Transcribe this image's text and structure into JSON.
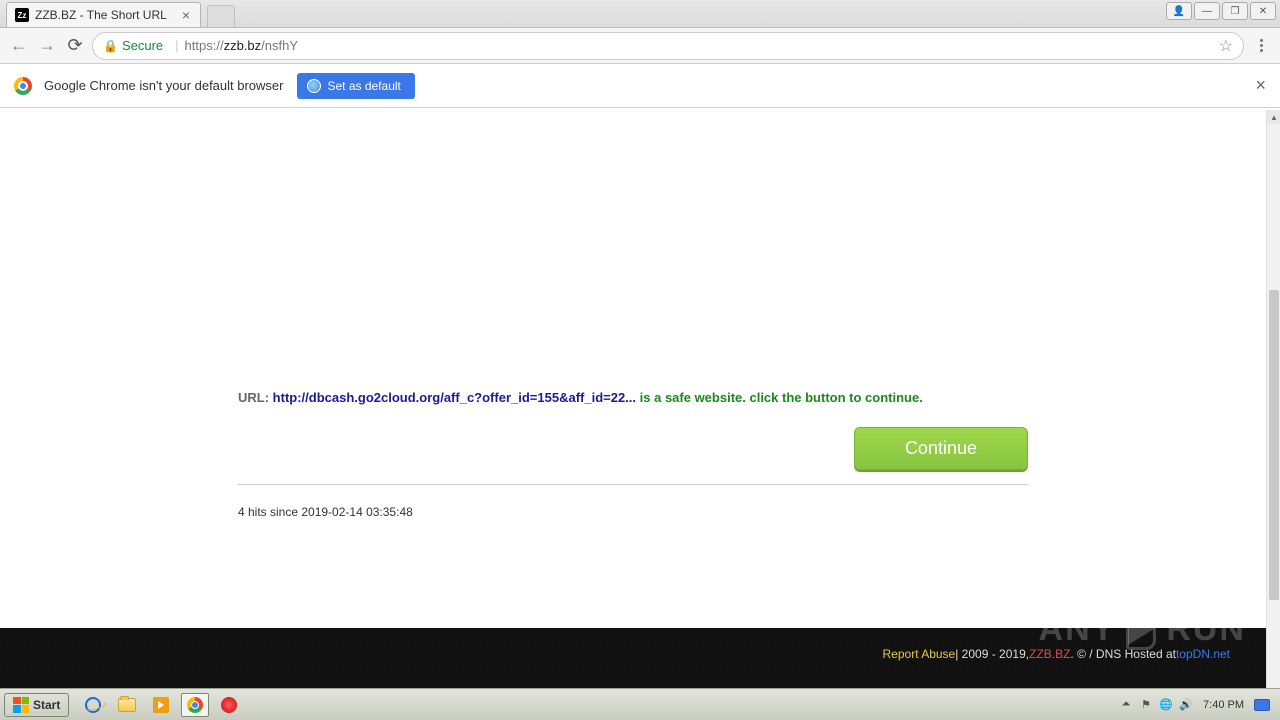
{
  "tab": {
    "title": "ZZB.BZ - The Short URL",
    "favicon_text": "Zz"
  },
  "window_controls": {
    "user": "user",
    "minimize": "minimize",
    "maximize": "maximize",
    "close": "close"
  },
  "toolbar": {
    "secure_label": "Secure",
    "url_prefix": "https://",
    "url_host": "zzb.bz",
    "url_path": "/nsfhY"
  },
  "infobar": {
    "message": "Google Chrome isn't your default browser",
    "set_default_label": "Set as default"
  },
  "page": {
    "url_label": "URL: ",
    "url_value": "http://dbcash.go2cloud.org/aff_c?offer_id=155&aff_id=22...",
    "safe_msg": " is a safe website. click the button to continue.",
    "continue_label": "Continue",
    "hits_text": "4 hits since 2019-02-14 03:35:48"
  },
  "footer": {
    "report_abuse": "Report Abuse",
    "years": " | 2009 - 2019, ",
    "brand": "ZZB.BZ",
    "hosted_pre": ". © / DNS Hosted at ",
    "hosted_link": "topDN.net"
  },
  "watermark": {
    "left": "ANY",
    "right": "RUN"
  },
  "taskbar": {
    "start_label": "Start",
    "clock": "7:40 PM"
  }
}
